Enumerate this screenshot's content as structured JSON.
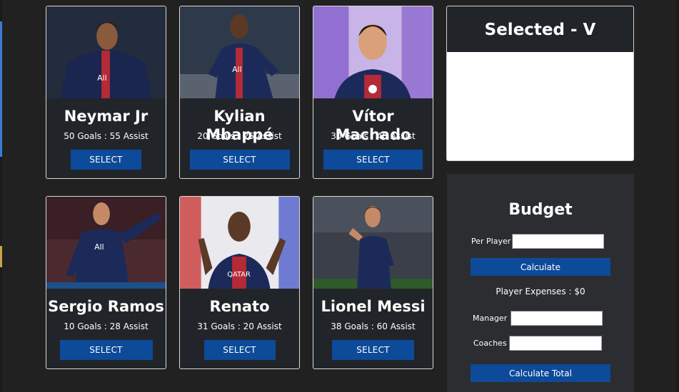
{
  "players": [
    {
      "name": "Neymar Jr",
      "stats": "50 Goals : 55 Assist",
      "select_label": "SELECT",
      "photo": "neymar-photo"
    },
    {
      "name": "Kylian Mbappé",
      "stats": "20 Goals : 25 Assist",
      "select_label": "SELECT",
      "photo": "mbappe-photo"
    },
    {
      "name": "Vítor Machado",
      "stats": "30 Goals : 40 Assist",
      "select_label": "SELECT",
      "photo": "machado-photo"
    },
    {
      "name": "Sergio Ramos",
      "stats": "10 Goals : 28 Assist",
      "select_label": "SELECT",
      "photo": "ramos-photo"
    },
    {
      "name": "Renato",
      "stats": "31 Goals : 20 Assist",
      "select_label": "SELECT",
      "photo": "renato-photo"
    },
    {
      "name": "Lionel Messi",
      "stats": "38 Goals : 60 Assist",
      "select_label": "SELECT",
      "photo": "messi-photo"
    }
  ],
  "selected": {
    "title": "Selected - V"
  },
  "budget": {
    "title": "Budget",
    "per_player_label": "Per Player :",
    "per_player_value": "",
    "calculate_label": "Calculate",
    "expenses_label": "Player Expenses : $0",
    "manager_label": "Manager :",
    "manager_value": "",
    "coaches_label": "Coaches :",
    "coaches_value": "",
    "calculate_total_label": "Calculate Total"
  },
  "colors": {
    "accent": "#0d4a99",
    "card_bg": "#212529",
    "page_bg": "#212121",
    "jersey": "#1c2a5a"
  }
}
